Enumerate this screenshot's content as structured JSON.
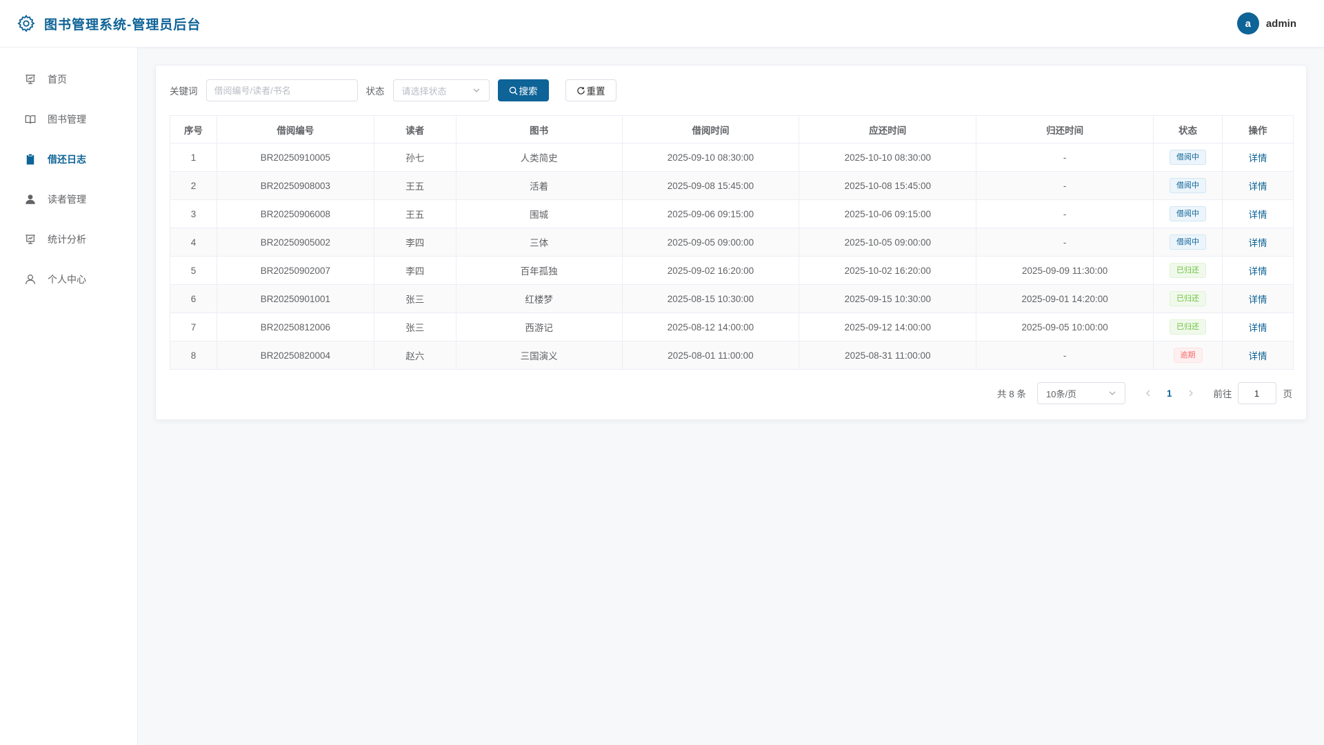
{
  "header": {
    "title": "图书管理系统-管理员后台",
    "avatar_letter": "a",
    "username": "admin"
  },
  "sidebar": {
    "items": [
      {
        "label": "首页",
        "icon": "home-chart-icon",
        "active": false
      },
      {
        "label": "图书管理",
        "icon": "book-icon",
        "active": false
      },
      {
        "label": "借还日志",
        "icon": "clipboard-icon",
        "active": true
      },
      {
        "label": "读者管理",
        "icon": "user-filled-icon",
        "active": false
      },
      {
        "label": "统计分析",
        "icon": "chart-icon",
        "active": false
      },
      {
        "label": "个人中心",
        "icon": "user-icon",
        "active": false
      }
    ]
  },
  "filters": {
    "keyword_label": "关键词",
    "keyword_placeholder": "借阅编号/读者/书名",
    "keyword_value": "",
    "status_label": "状态",
    "status_placeholder": "请选择状态",
    "search_label": "搜索",
    "reset_label": "重置"
  },
  "table": {
    "columns": [
      "序号",
      "借阅编号",
      "读者",
      "图书",
      "借阅时间",
      "应还时间",
      "归还时间",
      "状态",
      "操作"
    ],
    "rows": [
      {
        "index": "1",
        "id": "BR20250910005",
        "reader": "孙七",
        "book": "人类简史",
        "borrow_time": "2025-09-10 08:30:00",
        "due_time": "2025-10-10 08:30:00",
        "return_time": "-",
        "status": "借阅中",
        "status_type": "borrow",
        "action": "详情"
      },
      {
        "index": "2",
        "id": "BR20250908003",
        "reader": "王五",
        "book": "活着",
        "borrow_time": "2025-09-08 15:45:00",
        "due_time": "2025-10-08 15:45:00",
        "return_time": "-",
        "status": "借阅中",
        "status_type": "borrow",
        "action": "详情"
      },
      {
        "index": "3",
        "id": "BR20250906008",
        "reader": "王五",
        "book": "围城",
        "borrow_time": "2025-09-06 09:15:00",
        "due_time": "2025-10-06 09:15:00",
        "return_time": "-",
        "status": "借阅中",
        "status_type": "borrow",
        "action": "详情"
      },
      {
        "index": "4",
        "id": "BR20250905002",
        "reader": "李四",
        "book": "三体",
        "borrow_time": "2025-09-05 09:00:00",
        "due_time": "2025-10-05 09:00:00",
        "return_time": "-",
        "status": "借阅中",
        "status_type": "borrow",
        "action": "详情"
      },
      {
        "index": "5",
        "id": "BR20250902007",
        "reader": "李四",
        "book": "百年孤独",
        "borrow_time": "2025-09-02 16:20:00",
        "due_time": "2025-10-02 16:20:00",
        "return_time": "2025-09-09 11:30:00",
        "status": "已归还",
        "status_type": "return",
        "action": "详情"
      },
      {
        "index": "6",
        "id": "BR20250901001",
        "reader": "张三",
        "book": "红楼梦",
        "borrow_time": "2025-08-15 10:30:00",
        "due_time": "2025-09-15 10:30:00",
        "return_time": "2025-09-01 14:20:00",
        "status": "已归还",
        "status_type": "return",
        "action": "详情"
      },
      {
        "index": "7",
        "id": "BR20250812006",
        "reader": "张三",
        "book": "西游记",
        "borrow_time": "2025-08-12 14:00:00",
        "due_time": "2025-09-12 14:00:00",
        "return_time": "2025-09-05 10:00:00",
        "status": "已归还",
        "status_type": "return",
        "action": "详情"
      },
      {
        "index": "8",
        "id": "BR20250820004",
        "reader": "赵六",
        "book": "三国演义",
        "borrow_time": "2025-08-01 11:00:00",
        "due_time": "2025-08-31 11:00:00",
        "return_time": "-",
        "status": "逾期",
        "status_type": "overdue",
        "action": "详情"
      }
    ]
  },
  "pagination": {
    "total_text": "共 8 条",
    "page_size": "10条/页",
    "current_page": "1",
    "goto_label": "前往",
    "goto_value": "1",
    "page_suffix": "页"
  },
  "colors": {
    "brand": "#0e6397",
    "returned": "#67c23a",
    "overdue": "#f56c6c"
  }
}
